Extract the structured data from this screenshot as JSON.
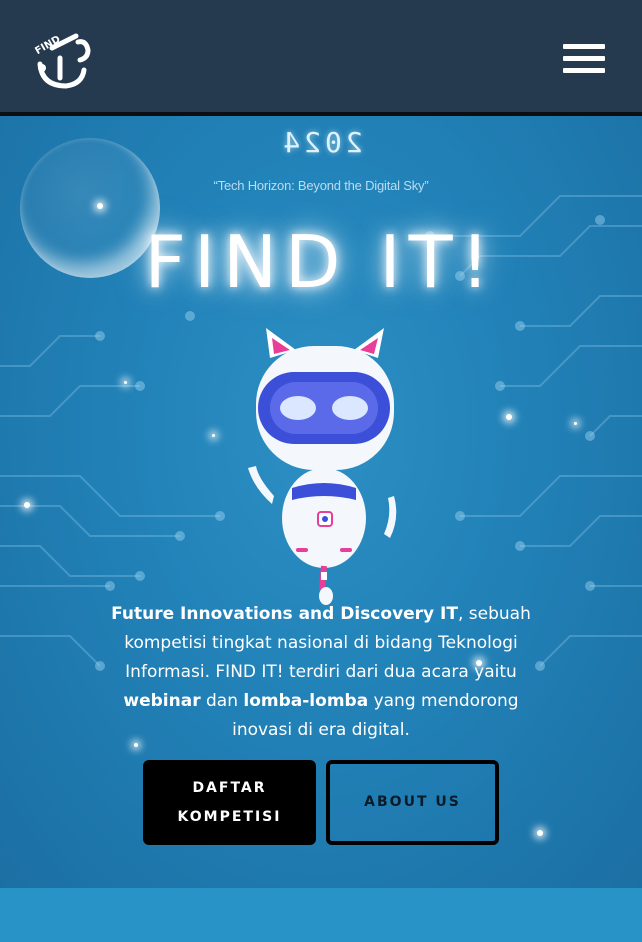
{
  "navbar": {
    "logo_icon": "find-it-logo-icon",
    "logo_text": "FIND",
    "menu_icon": "hamburger-menu-icon"
  },
  "hero": {
    "year": "2024",
    "tagline": "“Tech Horizon: Beyond the Digital Sky”",
    "title": "FIND IT!",
    "mascot_icon": "robot-cat-mascot-icon",
    "description": {
      "part1_bold": "Future Innovations and Discovery IT",
      "part2": ", sebuah kompetisi tingkat nasional di bidang Teknologi Informasi. FIND IT! terdiri dari dua acara yaitu ",
      "part3_bold": "webinar",
      "part4": " dan ",
      "part5_bold": "lomba-lomba",
      "part6": " yang mendorong inovasi di era digital."
    },
    "buttons": {
      "register_line1": "DAFTAR",
      "register_line2": "KOMPETISI",
      "about": "ABOUT US"
    }
  },
  "colors": {
    "navbar_bg": "#253a4f",
    "hero_bg": "#2283b9",
    "button_dark": "#000000",
    "accent_pink": "#e83e9a",
    "accent_blue": "#3b4fd8"
  }
}
